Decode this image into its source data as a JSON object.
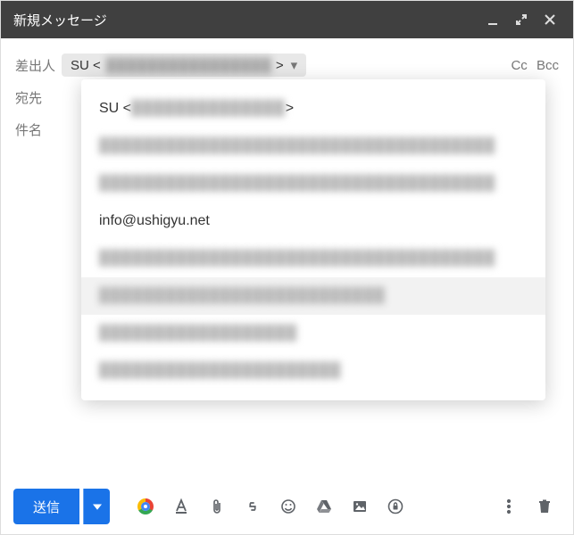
{
  "title": "新規メッセージ",
  "labels": {
    "from": "差出人",
    "to": "宛先",
    "subject": "件名",
    "cc": "Cc",
    "bcc": "Bcc",
    "send": "送信"
  },
  "from_display": {
    "prefix": "SU <",
    "redacted": "████████████████",
    "suffix": ">"
  },
  "from_dropdown": [
    {
      "text": "SU <████████████████>",
      "redacted": true,
      "clearPrefix": "SU <",
      "clearSuffix": ">"
    },
    {
      "text": "████████████████████████████████████",
      "redacted": true
    },
    {
      "text": "████████████████████████████████████",
      "redacted": true
    },
    {
      "text": "info@ushigyu.net",
      "redacted": false
    },
    {
      "text": "████████████████████████████████████",
      "redacted": true
    },
    {
      "text": "██████████████████████████",
      "redacted": true,
      "selected": true
    },
    {
      "text": "██████████████████",
      "redacted": true
    },
    {
      "text": "██████████████████████",
      "redacted": true
    }
  ],
  "to_value": "",
  "subject_value": ""
}
